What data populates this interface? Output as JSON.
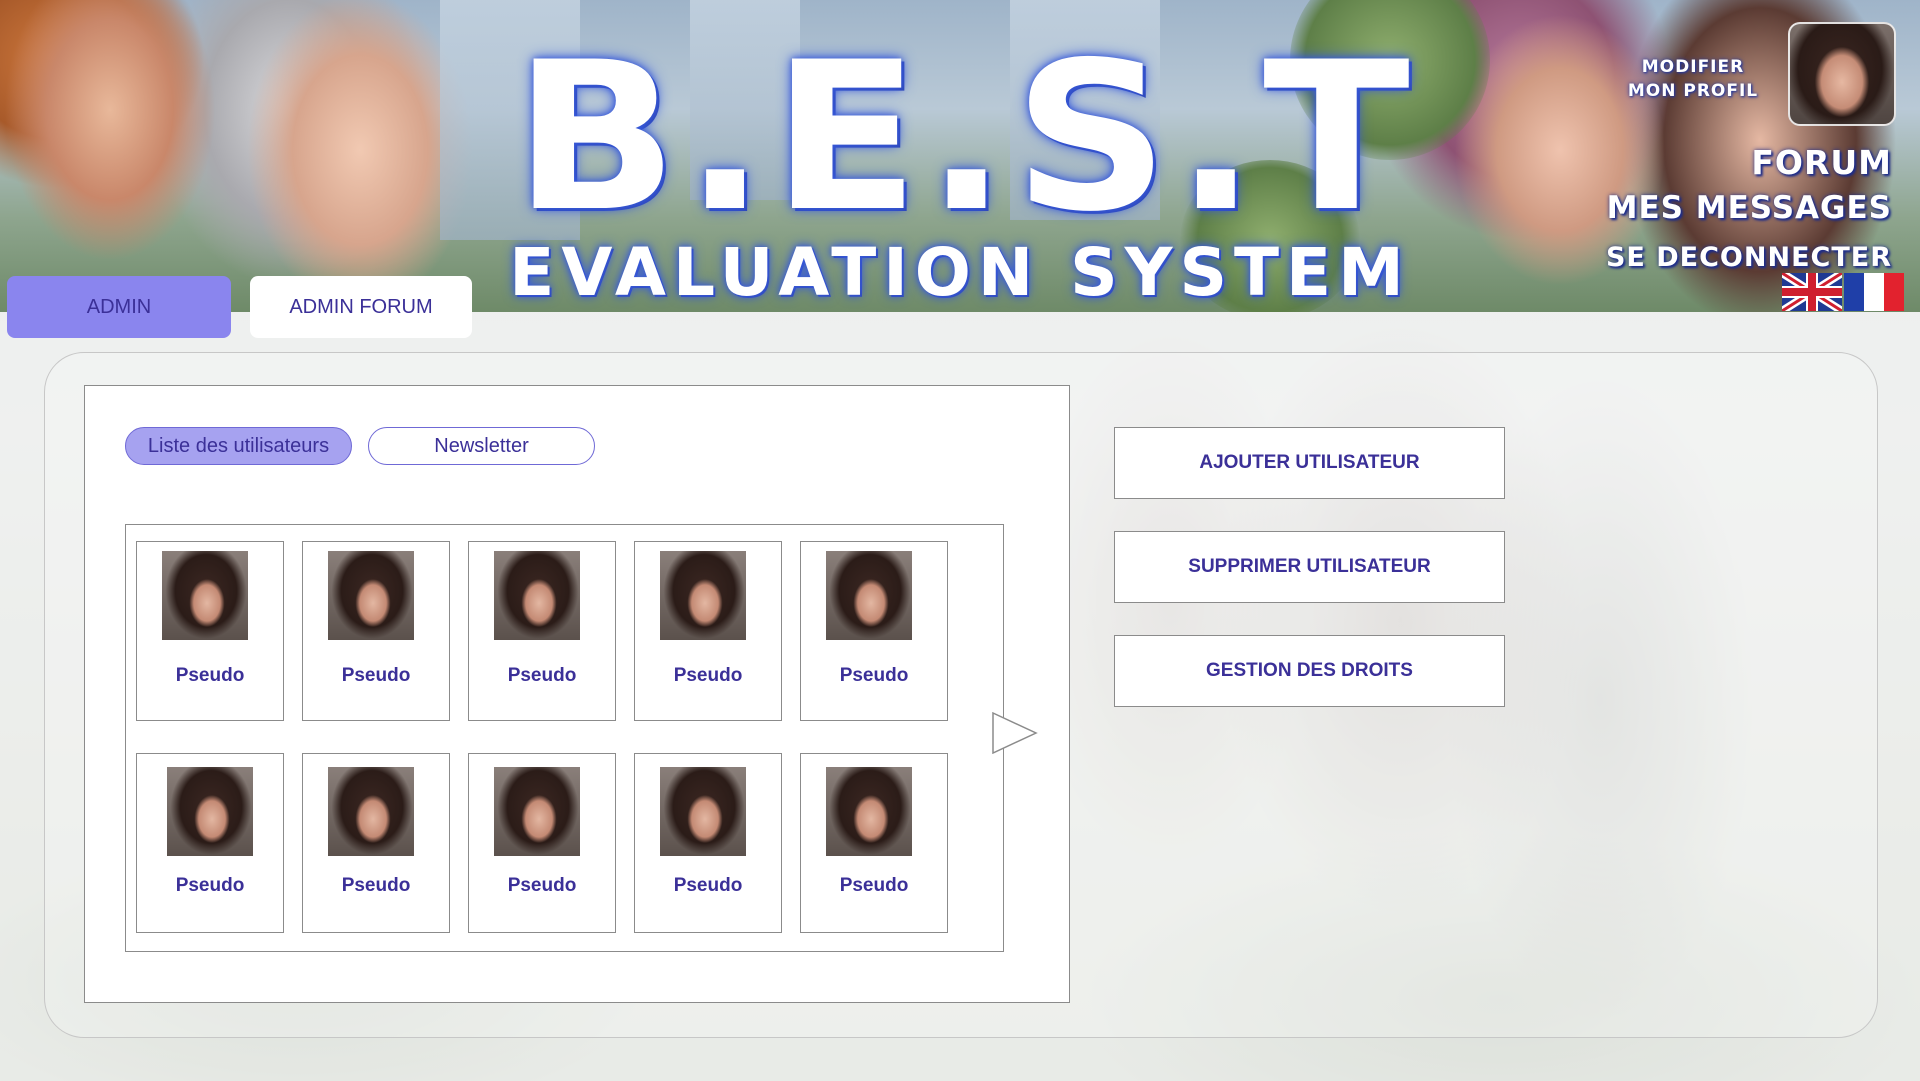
{
  "header": {
    "logo_title": "B.E.S.T",
    "logo_subtitle": "EVALUATION SYSTEM",
    "profile_link_line1": "MODIFIER",
    "profile_link_line2": "MON PROFIL",
    "nav": {
      "forum": "FORUM",
      "messages": "MES MESSAGES",
      "logout": "SE DECONNECTER"
    },
    "languages": [
      "en",
      "fr"
    ]
  },
  "tabs": {
    "admin": "ADMIN",
    "admin_forum": "ADMIN FORUM",
    "active": "admin"
  },
  "users_panel": {
    "subtabs": {
      "users_list": "Liste des utilisateurs",
      "newsletter": "Newsletter",
      "active": "users_list"
    },
    "users": [
      {
        "pseudo": "Pseudo"
      },
      {
        "pseudo": "Pseudo"
      },
      {
        "pseudo": "Pseudo"
      },
      {
        "pseudo": "Pseudo"
      },
      {
        "pseudo": "Pseudo"
      },
      {
        "pseudo": "Pseudo"
      },
      {
        "pseudo": "Pseudo"
      },
      {
        "pseudo": "Pseudo"
      },
      {
        "pseudo": "Pseudo"
      },
      {
        "pseudo": "Pseudo"
      }
    ]
  },
  "actions": {
    "add_user": "AJOUTER UTILISATEUR",
    "delete_user": "SUPPRIMER UTILISATEUR",
    "rights_management": "GESTION DES DROITS"
  },
  "colors": {
    "accent": "#3b3098",
    "tab_active": "#8a85ee",
    "pill_active": "#a6a2f0",
    "logo_glow": "#3357e0"
  },
  "icons": {
    "next": "triangle-right-icon",
    "flag_en": "uk-flag-icon",
    "flag_fr": "france-flag-icon"
  }
}
